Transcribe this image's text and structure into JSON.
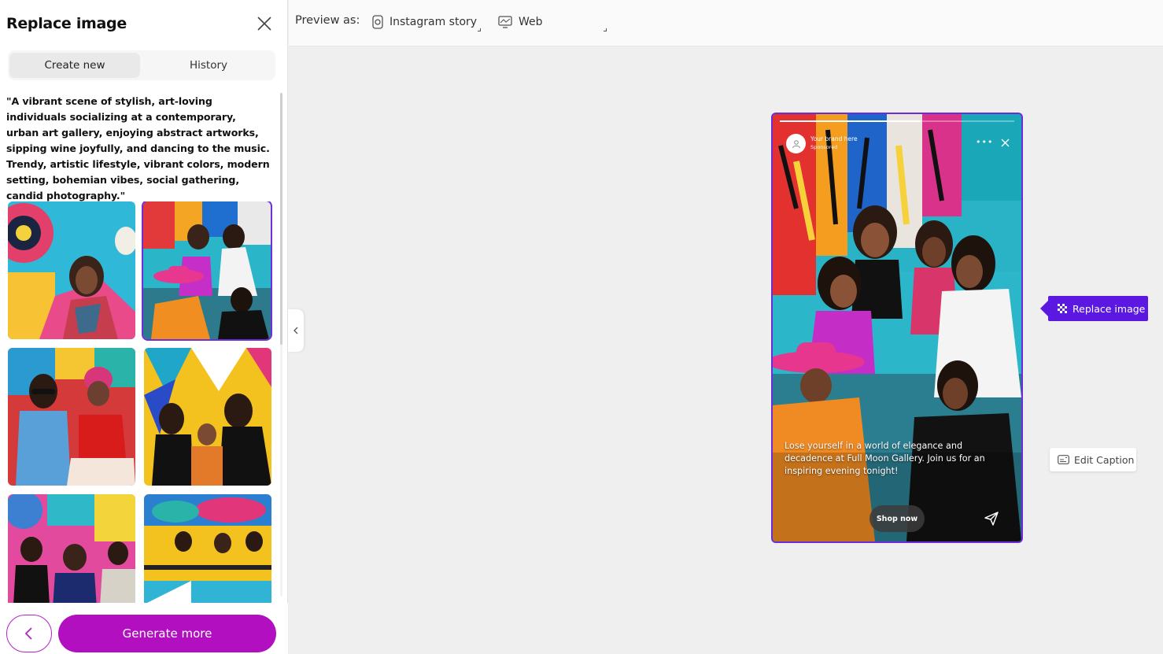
{
  "panel": {
    "title": "Replace image",
    "tabs": [
      {
        "label": "Create new",
        "active": true
      },
      {
        "label": "History",
        "active": false
      }
    ],
    "prompt": "\"A vibrant scene of stylish, art-loving individuals socializing at a contemporary, urban art gallery, enjoying abstract artworks, sipping wine joyfully, and dancing to the music. Trendy, artistic lifestyle, vibrant colors, modern setting, bohemian vibes, social gathering, candid photography.\"",
    "selected_image_index": 1,
    "images": [
      {
        "name": "woman-with-scarf-and-wine"
      },
      {
        "name": "group-with-pink-hat"
      },
      {
        "name": "women-with-sunglasses"
      },
      {
        "name": "group-with-geometric-wall"
      },
      {
        "name": "crowd-at-colorful-mural"
      },
      {
        "name": "people-at-yellow-gallery"
      }
    ],
    "generate_label": "Generate more"
  },
  "topbar": {
    "preview_label": "Preview as:",
    "options": [
      {
        "label": "Instagram story",
        "icon": "instagram-icon"
      },
      {
        "label": "Web",
        "icon": "monitor-icon"
      }
    ]
  },
  "story": {
    "brand": "Your brand here",
    "sponsored": "Sponsored",
    "caption": "Lose yourself in a world of elegance and decadence at Full Moon Gallery. Join us for an inspiring evening tonight!",
    "cta": "Shop now",
    "progress": 0.6
  },
  "actions": {
    "replace_image": "Replace image",
    "edit_caption": "Edit Caption"
  },
  "colors": {
    "accent_purple": "#b10fbf",
    "selection_purple": "#6a2bd9",
    "replace_tag": "#5a18e0"
  }
}
